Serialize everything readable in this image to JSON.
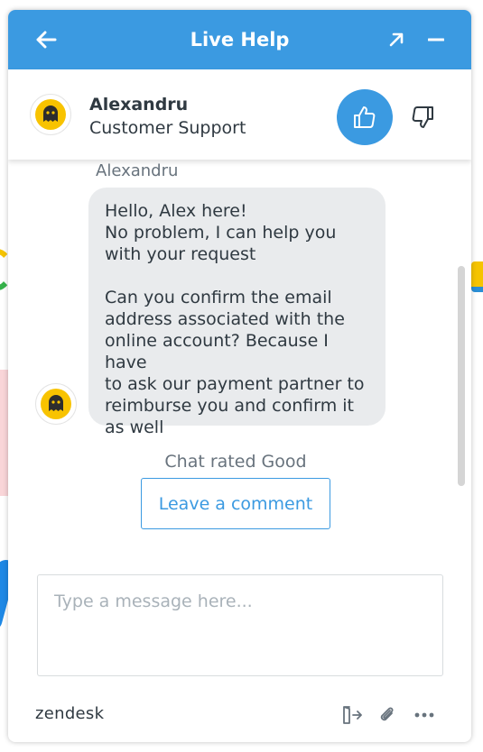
{
  "colors": {
    "accent": "#3b9ae1",
    "bubble": "#e9ebed",
    "text": "#2f3941",
    "muted": "#68737d"
  },
  "header": {
    "title": "Live Help",
    "back_icon": "arrow-left-icon",
    "popout_icon": "arrow-up-right-icon",
    "minimize_icon": "minus-icon"
  },
  "agent": {
    "name": "Alexandru",
    "role": "Customer Support",
    "avatar_icon": "ghost-avatar-icon",
    "rate_good_icon": "thumbs-up-icon",
    "rate_bad_icon": "thumbs-down-icon"
  },
  "conversation": {
    "sender": "Alexandru",
    "message_lines": [
      "Hello, Alex here!",
      "No problem, I can help you",
      "with your request"
    ],
    "message_lines_2": [
      "Can you confirm the email",
      "address associated with the",
      "online account? Because I have",
      "to ask our payment partner to",
      "reimburse you and confirm it",
      "as well"
    ],
    "rating_status": "Chat rated Good",
    "comment_button": "Leave a comment"
  },
  "composer": {
    "placeholder": "Type a message here..."
  },
  "footer": {
    "brand": "zendesk",
    "end_chat_icon": "end-chat-icon",
    "attach_icon": "paperclip-icon",
    "more_icon": "more-options-icon"
  }
}
